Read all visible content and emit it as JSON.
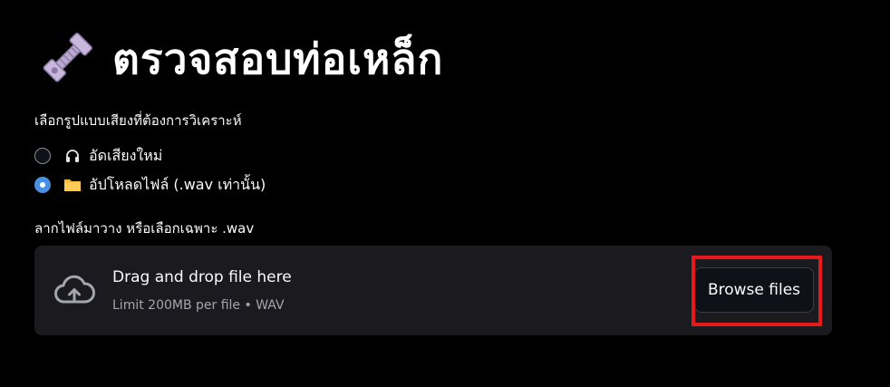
{
  "header": {
    "icon": "nut-and-bolt-icon",
    "title": "ตรวจสอบท่อเหล็ก"
  },
  "mode_select": {
    "label": "เลือกรูปแบบเสียงที่ต้องการวิเคราะห์",
    "options": [
      {
        "icon": "headphone-icon",
        "label": "อัดเสียงใหม่",
        "selected": false
      },
      {
        "icon": "folder-icon",
        "label": "อัปโหลดไฟล์ (.wav เท่านั้น)",
        "selected": true
      }
    ]
  },
  "uploader": {
    "label": "ลากไฟล์มาวาง หรือเลือกเฉพาะ .wav",
    "icon": "cloud-upload-icon",
    "title": "Drag and drop file here",
    "subtitle": "Limit 200MB per file • WAV",
    "browse_label": "Browse files"
  },
  "colors": {
    "background": "#000000",
    "dropzone": "#1b1b1f",
    "radio_selected": "#4a90e2",
    "highlight": "#e8191b"
  }
}
